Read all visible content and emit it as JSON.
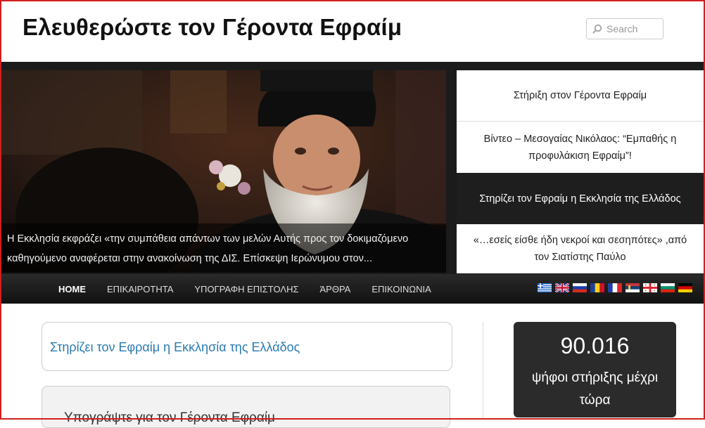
{
  "site": {
    "title": "Ελευθερώστε τον Γέροντα Εφραίμ"
  },
  "search": {
    "placeholder": "Search"
  },
  "hero": {
    "caption": "Η Εκκλησία εκφράζει «την συμπάθεια απάντων των μελών Αυτής προς τον δοκιμαζόμενο καθηγούμενο αναφέρεται στην ανακοίνωση της ΔΙΣ. Επίσκεψη Ιερώνυμου στον..."
  },
  "slider": {
    "items": [
      {
        "label": "Στήριξη στον Γέροντα Εφραίμ"
      },
      {
        "label": "Βίντεο – Μεσογαίας Νικόλαος: “Εμπαθής η προφυλάκιση Εφραίμ”!"
      },
      {
        "label": "Στηρίζει τον Εφραίμ η Εκκλησία της Ελλάδος"
      },
      {
        "label": "«…εσείς είσθε ήδη νεκροί και σεσηπότες» ,από τον Σιατίστης Παύλο"
      }
    ]
  },
  "nav": {
    "items": [
      {
        "label": "HOME"
      },
      {
        "label": "ΕΠΙΚΑΙΡΟΤΗΤΑ"
      },
      {
        "label": "ΥΠΟΓΡΑΦΗ ΕΠΙΣΤΟΛΗΣ"
      },
      {
        "label": "ΆΡΘΡΑ"
      },
      {
        "label": "ΕΠΙΚΟΙΝΩΝΙΑ"
      }
    ],
    "languages": [
      "greece-flag-icon",
      "uk-flag-icon",
      "russia-flag-icon",
      "romania-flag-icon",
      "france-flag-icon",
      "serbia-flag-icon",
      "georgia-flag-icon",
      "bulgaria-flag-icon",
      "germany-flag-icon"
    ]
  },
  "main": {
    "post_link": "Στηρίζει τον Εφραίμ η Εκκλησία της Ελλάδος",
    "next_title": "Υπογράψτε για τον Γέροντα Εφραίμ"
  },
  "counter": {
    "value": "90.016",
    "label": "ψήφοι στήριξης μέχρι τώρα"
  },
  "colors": {
    "accent": "#2a7bb0",
    "dark": "#1e1e1e",
    "frame": "#d01f1f"
  }
}
